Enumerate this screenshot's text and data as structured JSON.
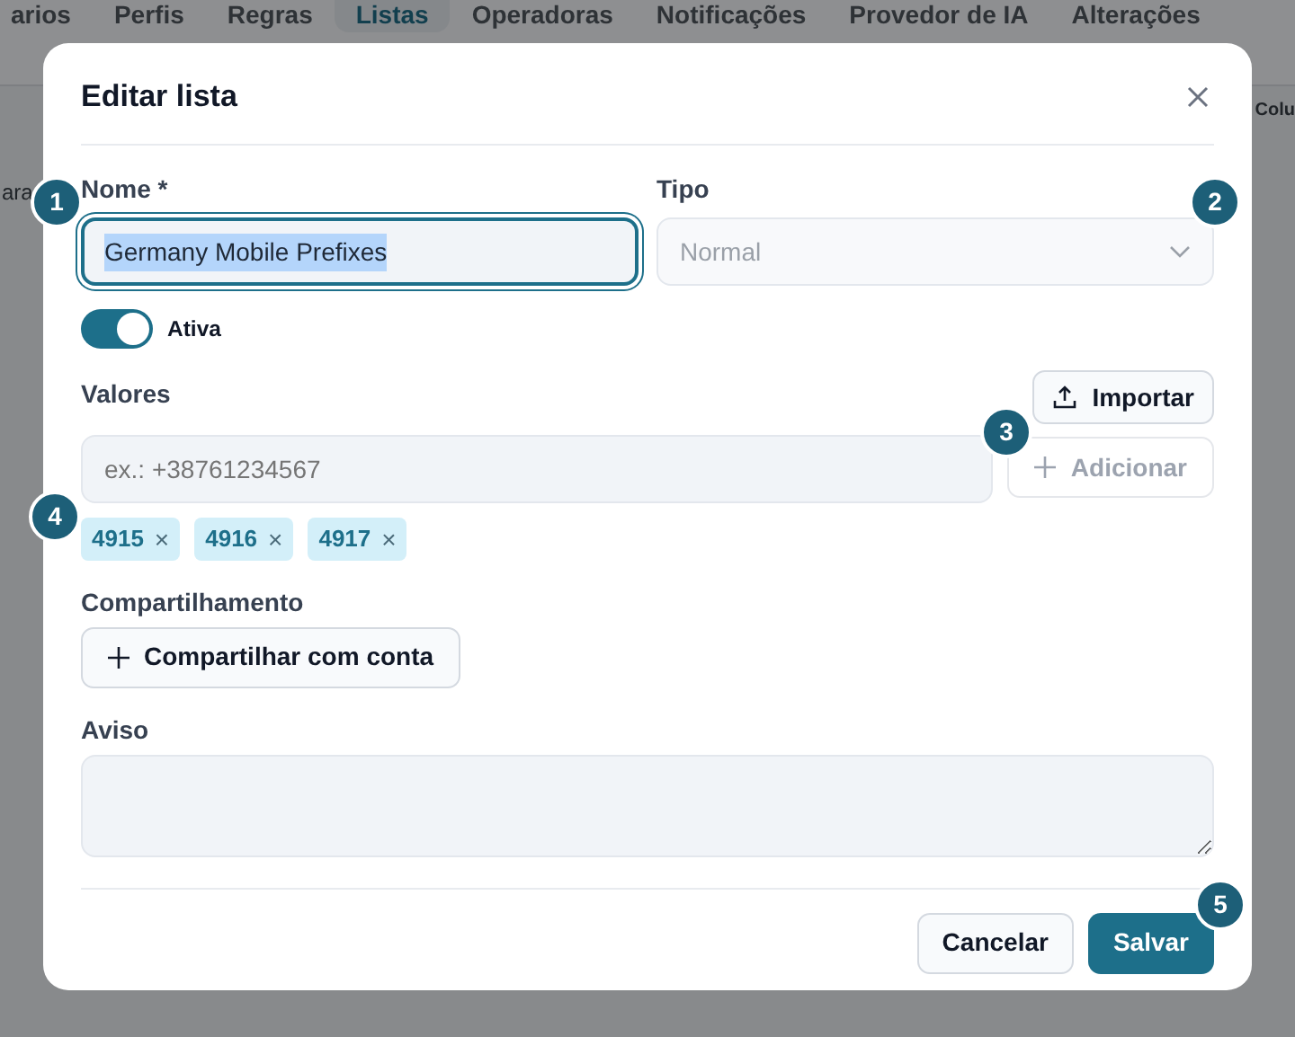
{
  "background": {
    "tabs": [
      {
        "label": "arios",
        "selected": false
      },
      {
        "label": "Perfis",
        "selected": false
      },
      {
        "label": "Regras",
        "selected": false
      },
      {
        "label": "Listas",
        "selected": true
      },
      {
        "label": "Operadoras",
        "selected": false
      },
      {
        "label": "Notificações",
        "selected": false
      },
      {
        "label": "Provedor de IA",
        "selected": false
      },
      {
        "label": "Alterações",
        "selected": false
      }
    ],
    "left_fragment": "ara",
    "right_fragment": "Colu"
  },
  "dialog": {
    "title": "Editar lista",
    "nome": {
      "marker": "1",
      "label": "Nome *",
      "value": "Germany Mobile Prefixes",
      "value_selected": true,
      "focused": true
    },
    "tipo": {
      "marker": "2",
      "label": "Tipo",
      "value": "Normal"
    },
    "ativa": {
      "label": "Ativa",
      "on": true
    },
    "valores": {
      "label": "Valores",
      "import_button": "Importar",
      "placeholder": "ex.: +38761234567",
      "add_button": "Adicionar",
      "add_marker": "3",
      "chips_marker": "4",
      "add_disabled": true,
      "chips": [
        {
          "label": "4915",
          "remove": "×"
        },
        {
          "label": "4916",
          "remove": "×"
        },
        {
          "label": "4917",
          "remove": "×"
        }
      ]
    },
    "compartilhamento": {
      "label": "Compartilhamento",
      "button": "Compartilhar com conta"
    },
    "aviso": {
      "label": "Aviso"
    },
    "buttons": [
      {
        "label": "Cancelar",
        "kind": "secondary"
      },
      {
        "label": "Salvar",
        "kind": "primary",
        "marker": "5"
      }
    ]
  }
}
